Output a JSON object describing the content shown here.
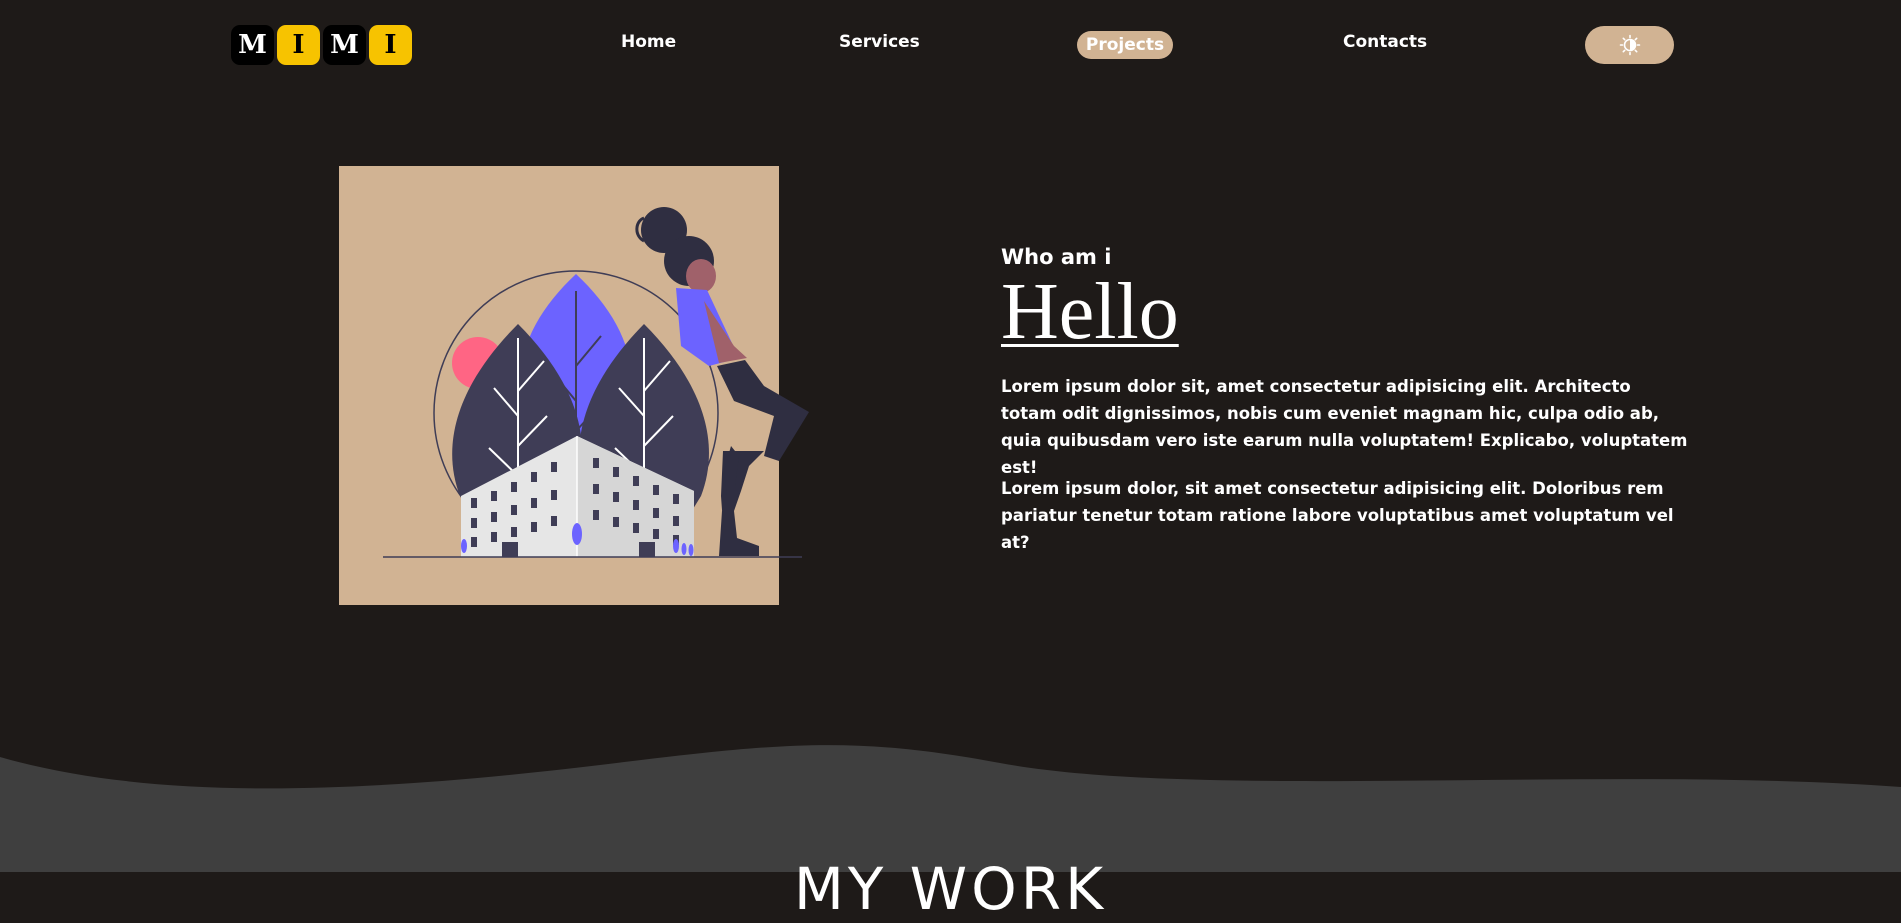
{
  "header": {
    "logo_letters": [
      "M",
      "I",
      "M",
      "I"
    ],
    "nav": [
      {
        "label": "Home"
      },
      {
        "label": "Services"
      },
      {
        "label": "Projects"
      },
      {
        "label": "Contacts"
      }
    ],
    "theme_toggle_icon": "sun-moon-icon"
  },
  "hero": {
    "subtitle": "Who am i",
    "title": "Hello",
    "paragraph1": "Lorem ipsum dolor sit, amet consectetur adipisicing elit. Architecto totam odit dignissimos, nobis cum eveniet magnam hic, culpa odio ab, quia quibusdam vero iste earum nulla voluptatem! Explicabo, voluptatem est!",
    "paragraph2": "Lorem ipsum dolor, sit amet consectetur adipisicing elit. Doloribus rem pariatur tenetur totam ratione labore voluptatibus amet voluptatum vel at?"
  },
  "next_section": {
    "title": "MY WORK"
  },
  "colors": {
    "background": "#1e1a18",
    "accent": "#d1b393",
    "logo_yellow": "#f7c300",
    "wave": "#3f3f3f",
    "illustration_purple": "#6c63ff"
  }
}
